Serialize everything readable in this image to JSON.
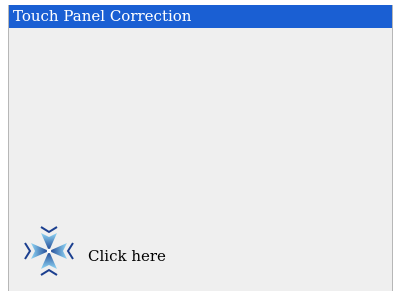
{
  "window": {
    "title": "Touch Panel Correction"
  },
  "calibration": {
    "prompt": "Click here",
    "target_icon": "calibration-crosshair-icon"
  },
  "colors": {
    "title_bar": "#1a5fd3",
    "title_text": "#ffffff",
    "background": "#efefef",
    "target_dark": "#1b3f8f",
    "target_light": "#8fd6f5"
  }
}
